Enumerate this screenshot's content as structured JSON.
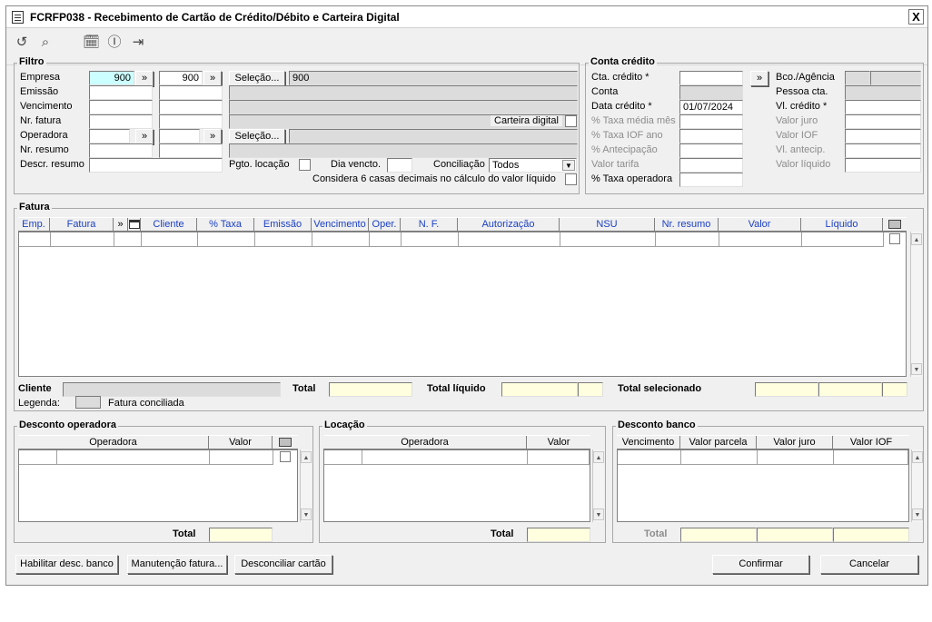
{
  "window": {
    "title": "FCRFP038 - Recebimento de Cartão de Crédito/Débito e Carteira Digital",
    "close_symbol": "X"
  },
  "toolbar": {
    "icons": [
      "undo-icon",
      "search-icon",
      "calendar-icon",
      "help-icon",
      "exit-icon"
    ]
  },
  "filtro": {
    "title": "Filtro",
    "empresa_label": "Empresa",
    "empresa_from": "900",
    "empresa_to": "900",
    "selecao_label": "Seleção...",
    "selecao_value": "900",
    "emissao_label": "Emissão",
    "vencimento_label": "Vencimento",
    "nr_fatura_label": "Nr. fatura",
    "carteira_digital_label": "Carteira digital",
    "operadora_label": "Operadora",
    "selecao2_label": "Seleção...",
    "nr_resumo_label": "Nr. resumo",
    "descr_resumo_label": "Descr. resumo",
    "pgto_locacao_label": "Pgto. locação",
    "dia_vencto_label": "Dia vencto.",
    "conciliacao_label": "Conciliação",
    "conciliacao_value": "Todos",
    "considera_label": "Considera 6 casas decimais no cálculo do valor líquido",
    "arrow_symbol": "»"
  },
  "conta_credito": {
    "title": "Conta crédito",
    "cta_credito_label": "Cta. crédito *",
    "conta_label": "Conta",
    "data_credito_label": "Data crédito *",
    "data_credito_value": "01/07/2024",
    "taxa_media_label": "% Taxa média mês",
    "taxa_iof_label": "% Taxa IOF ano",
    "antecipacao_label": "% Antecipação",
    "valor_tarifa_label": "Valor tarifa",
    "taxa_operadora_label": "% Taxa operadora",
    "bco_agencia_label": "Bco./Agência",
    "pessoa_cta_label": "Pessoa cta.",
    "vl_credito_label": "Vl. crédito *",
    "valor_juro_label": "Valor juro",
    "valor_iof_label": "Valor IOF",
    "vl_antecip_label": "Vl. antecip.",
    "valor_liquido_label": "Valor líquido",
    "arrow_symbol": "»"
  },
  "fatura": {
    "title": "Fatura",
    "columns": [
      "Emp.",
      "Fatura",
      "»",
      "",
      "Cliente",
      "% Taxa",
      "Emissão",
      "Vencimento",
      "Oper.",
      "N. F.",
      "Autorização",
      "NSU",
      "Nr. resumo",
      "Valor",
      "Líquido"
    ],
    "cliente_label": "Cliente",
    "total_label": "Total",
    "total_liquido_label": "Total líquido",
    "total_selecionado_label": "Total selecionado",
    "legenda_label": "Legenda:",
    "fatura_conciliada_label": "Fatura conciliada"
  },
  "desconto_operadora": {
    "title": "Desconto operadora",
    "columns": [
      "Operadora",
      "Valor"
    ],
    "total_label": "Total"
  },
  "locacao": {
    "title": "Locação",
    "columns": [
      "Operadora",
      "Valor"
    ],
    "total_label": "Total"
  },
  "desconto_banco": {
    "title": "Desconto banco",
    "columns": [
      "Vencimento",
      "Valor parcela",
      "Valor juro",
      "Valor IOF"
    ],
    "total_label": "Total"
  },
  "buttons": {
    "habilitar": "Habilitar desc. banco",
    "manutencao": "Manutenção fatura...",
    "desconciliar": "Desconciliar cartão",
    "confirmar": "Confirmar",
    "cancelar": "Cancelar"
  }
}
